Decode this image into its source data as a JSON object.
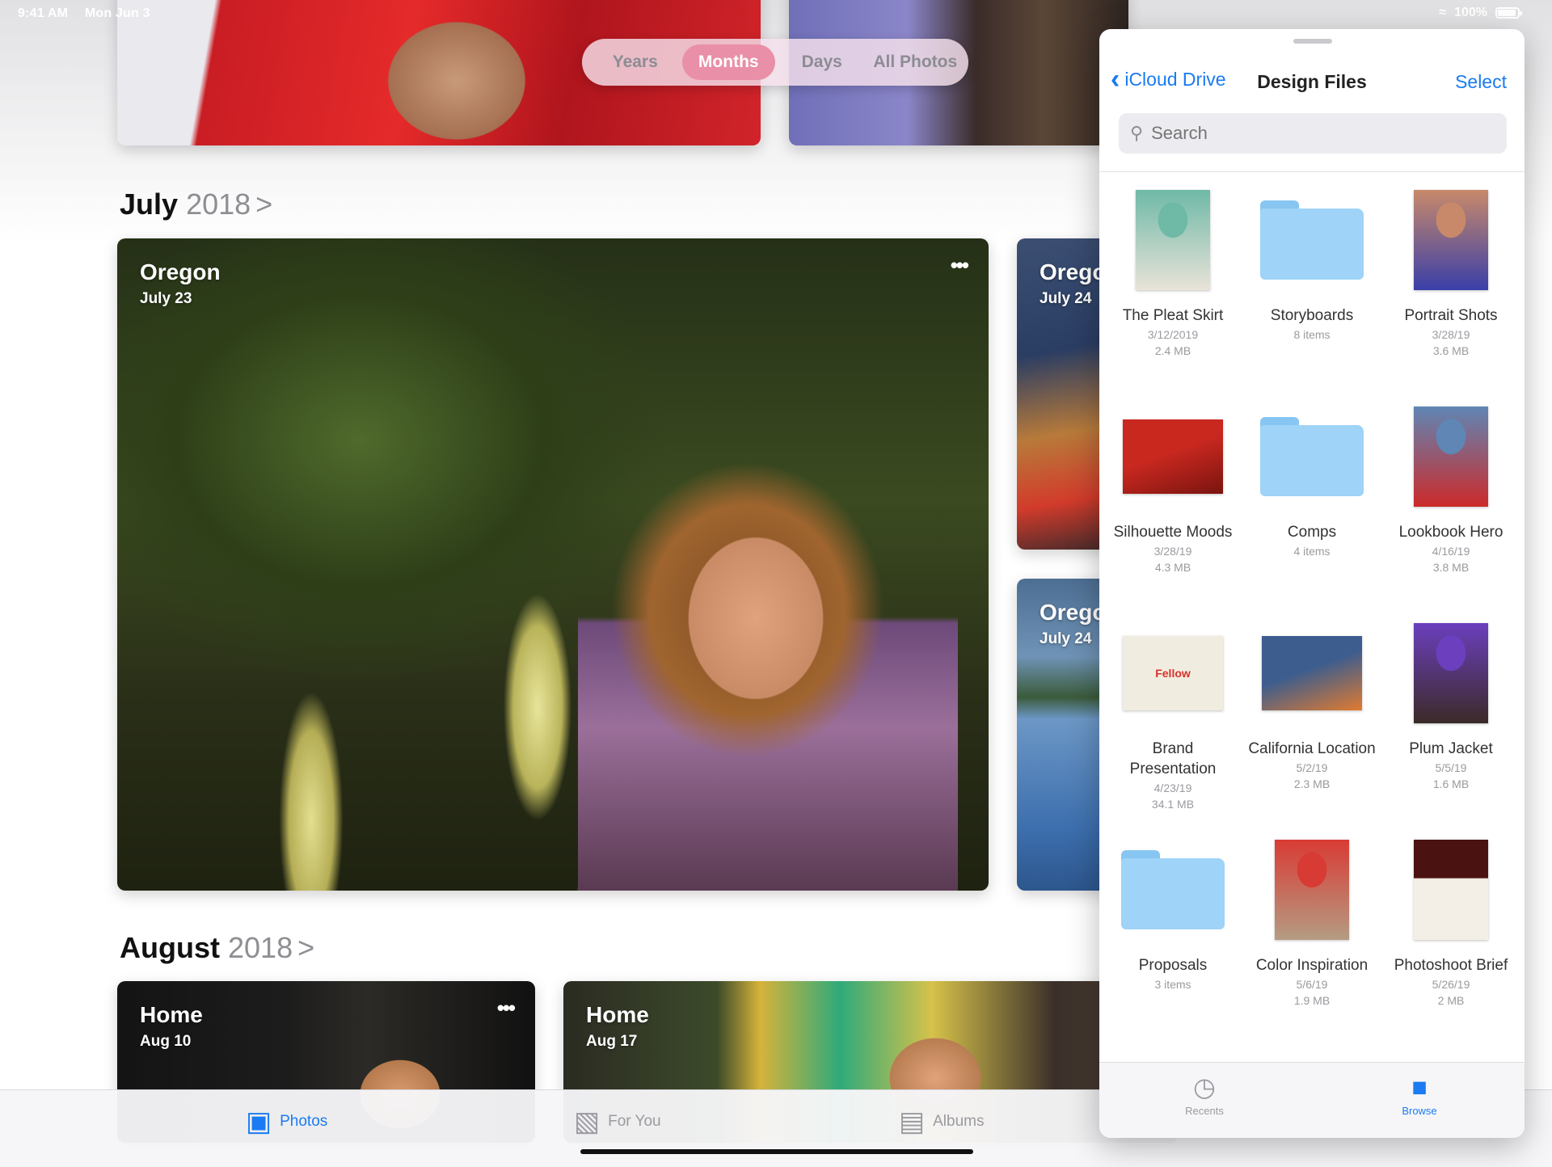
{
  "status_bar": {
    "time": "9:41 AM",
    "date": "Mon Jun 3",
    "battery": "100%",
    "battery_level": 1.0
  },
  "photos": {
    "segments": [
      {
        "label": "Years",
        "active": false
      },
      {
        "label": "Months",
        "active": true
      },
      {
        "label": "Days",
        "active": false
      },
      {
        "label": "All Photos",
        "active": false
      }
    ],
    "sections": [
      {
        "month": "July",
        "year": "2018",
        "chevron": ">"
      },
      {
        "month": "August",
        "year": "2018",
        "chevron": ">"
      }
    ],
    "cards": {
      "oregon_main": {
        "title": "Oregon",
        "date": "July 23",
        "more": "•••"
      },
      "oregon_side_1": {
        "title": "Oregon",
        "date": "July 24"
      },
      "oregon_side_2": {
        "title": "Oregon",
        "date": "July 24"
      },
      "home_1": {
        "title": "Home",
        "date": "Aug 10",
        "more": "•••"
      },
      "home_2": {
        "title": "Home",
        "date": "Aug 17"
      }
    },
    "tabs": [
      {
        "label": "Photos",
        "icon": "photos-icon",
        "active": true
      },
      {
        "label": "For You",
        "icon": "for-you-icon",
        "active": false
      },
      {
        "label": "Albums",
        "icon": "albums-icon",
        "active": false
      }
    ]
  },
  "files": {
    "back_label": "iCloud Drive",
    "title": "Design Files",
    "select_label": "Select",
    "search_placeholder": "Search",
    "items": [
      {
        "name": "The Pleat Skirt",
        "meta1": "3/12/2019",
        "meta2": "2.4 MB",
        "kind": "photo",
        "colors": [
          "#6fb9a7",
          "#e9e3d9"
        ]
      },
      {
        "name": "Storyboards",
        "meta1": "8 items",
        "meta2": "",
        "kind": "folder"
      },
      {
        "name": "Portrait Shots",
        "meta1": "3/28/19",
        "meta2": "3.6 MB",
        "kind": "photo",
        "colors": [
          "#c8896a",
          "#3a3fa8"
        ]
      },
      {
        "name": "Silhouette Moods",
        "meta1": "3/28/19",
        "meta2": "4.3 MB",
        "kind": "photo-landscape",
        "colors": [
          "#c9281f",
          "#7a1410"
        ]
      },
      {
        "name": "Comps",
        "meta1": "4 items",
        "meta2": "",
        "kind": "folder"
      },
      {
        "name": "Lookbook Hero",
        "meta1": "4/16/19",
        "meta2": "3.8 MB",
        "kind": "photo",
        "colors": [
          "#5f86b5",
          "#cc2a2a"
        ]
      },
      {
        "name": "Brand Presentation",
        "meta1": "4/23/19",
        "meta2": "34.1 MB",
        "kind": "doc",
        "colors": [
          "#f1ece0",
          "#d8322c"
        ],
        "doc_text": "Fellow"
      },
      {
        "name": "California Location",
        "meta1": "5/2/19",
        "meta2": "2.3 MB",
        "kind": "photo-landscape",
        "colors": [
          "#3d5d8e",
          "#e17b2f"
        ]
      },
      {
        "name": "Plum Jacket",
        "meta1": "5/5/19",
        "meta2": "1.6 MB",
        "kind": "photo",
        "colors": [
          "#6b3fbd",
          "#3b2a28"
        ]
      },
      {
        "name": "Proposals",
        "meta1": "3 items",
        "meta2": "",
        "kind": "folder"
      },
      {
        "name": "Color Inspiration",
        "meta1": "5/6/19",
        "meta2": "1.9 MB",
        "kind": "photo",
        "colors": [
          "#d83b34",
          "#b59c83"
        ]
      },
      {
        "name": "Photoshoot Brief",
        "meta1": "5/26/19",
        "meta2": "2 MB",
        "kind": "doc-dark",
        "colors": [
          "#4a1210",
          "#f3efe6"
        ]
      }
    ],
    "tabs": [
      {
        "label": "Recents",
        "icon": "clock-icon",
        "active": false
      },
      {
        "label": "Browse",
        "icon": "folder-icon",
        "active": true
      }
    ]
  },
  "colors": {
    "accent": "#1a7bf2",
    "folder": "#9fd3f7",
    "segment_active": "#e98fa8"
  }
}
